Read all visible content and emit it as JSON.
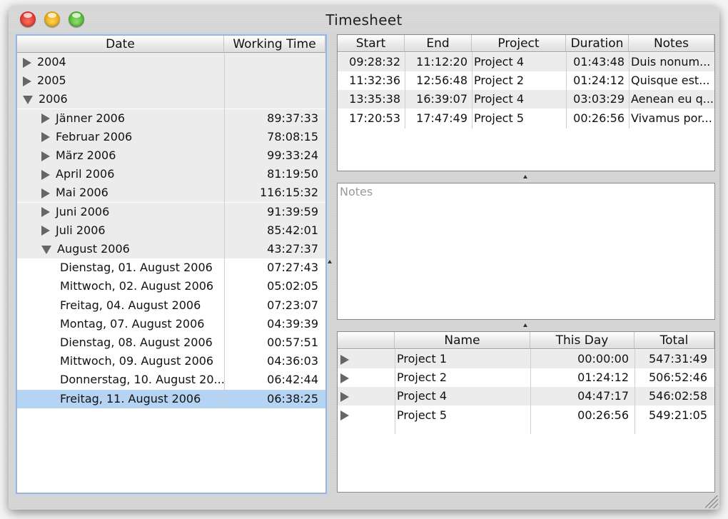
{
  "window": {
    "title": "Timesheet"
  },
  "tree": {
    "headers": {
      "date": "Date",
      "working_time": "Working Time"
    },
    "rows": [
      {
        "label": "2004",
        "time": "",
        "level": 0,
        "disclosure": "collapsed"
      },
      {
        "label": "2005",
        "time": "",
        "level": 0,
        "disclosure": "collapsed"
      },
      {
        "label": "2006",
        "time": "",
        "level": 0,
        "disclosure": "expanded"
      },
      {
        "label": "Jänner 2006",
        "time": "89:37:33",
        "level": 1,
        "disclosure": "collapsed"
      },
      {
        "label": "Februar 2006",
        "time": "78:08:15",
        "level": 1,
        "disclosure": "collapsed"
      },
      {
        "label": "März 2006",
        "time": "99:33:24",
        "level": 1,
        "disclosure": "collapsed"
      },
      {
        "label": "April 2006",
        "time": "81:19:50",
        "level": 1,
        "disclosure": "collapsed"
      },
      {
        "label": "Mai 2006",
        "time": "116:15:32",
        "level": 1,
        "disclosure": "collapsed"
      },
      {
        "label": "Juni 2006",
        "time": "91:39:59",
        "level": 1,
        "disclosure": "collapsed"
      },
      {
        "label": "Juli 2006",
        "time": "85:42:01",
        "level": 1,
        "disclosure": "collapsed"
      },
      {
        "label": "August 2006",
        "time": "43:27:37",
        "level": 1,
        "disclosure": "expanded"
      },
      {
        "label": "Dienstag, 01. August 2006",
        "time": "07:27:43",
        "level": 2,
        "disclosure": "none"
      },
      {
        "label": "Mittwoch, 02. August 2006",
        "time": "05:02:05",
        "level": 2,
        "disclosure": "none"
      },
      {
        "label": "Freitag, 04. August 2006",
        "time": "07:23:07",
        "level": 2,
        "disclosure": "none"
      },
      {
        "label": "Montag, 07. August 2006",
        "time": "04:39:39",
        "level": 2,
        "disclosure": "none"
      },
      {
        "label": "Dienstag, 08. August 2006",
        "time": "00:57:51",
        "level": 2,
        "disclosure": "none"
      },
      {
        "label": "Mittwoch, 09. August 2006",
        "time": "04:36:03",
        "level": 2,
        "disclosure": "none"
      },
      {
        "label": "Donnerstag, 10. August 20...",
        "time": "06:42:44",
        "level": 2,
        "disclosure": "none"
      },
      {
        "label": "Freitag, 11. August 2006",
        "time": "06:38:25",
        "level": 2,
        "disclosure": "none",
        "selected": true
      }
    ]
  },
  "entries": {
    "headers": {
      "start": "Start",
      "end": "End",
      "project": "Project",
      "duration": "Duration",
      "notes": "Notes"
    },
    "rows": [
      {
        "start": "09:28:32",
        "end": "11:12:20",
        "project": "Project 4",
        "duration": "01:43:48",
        "notes": "Duis nonum..."
      },
      {
        "start": "11:32:36",
        "end": "12:56:48",
        "project": "Project 2",
        "duration": "01:24:12",
        "notes": "Quisque est..."
      },
      {
        "start": "13:35:38",
        "end": "16:39:07",
        "project": "Project 4",
        "duration": "03:03:29",
        "notes": "Aenean eu q..."
      },
      {
        "start": "17:20:53",
        "end": "17:47:49",
        "project": "Project 5",
        "duration": "00:26:56",
        "notes": "Vivamus por..."
      }
    ]
  },
  "notes": {
    "placeholder": "Notes"
  },
  "projects": {
    "headers": {
      "name": "Name",
      "this_day": "This Day",
      "total": "Total"
    },
    "rows": [
      {
        "name": "Project 1",
        "this_day": "00:00:00",
        "total": "547:31:49"
      },
      {
        "name": "Project 2",
        "this_day": "01:24:12",
        "total": "506:52:46"
      },
      {
        "name": "Project 4",
        "this_day": "04:47:17",
        "total": "546:02:58"
      },
      {
        "name": "Project 5",
        "this_day": "00:26:56",
        "total": "549:21:05"
      }
    ]
  }
}
